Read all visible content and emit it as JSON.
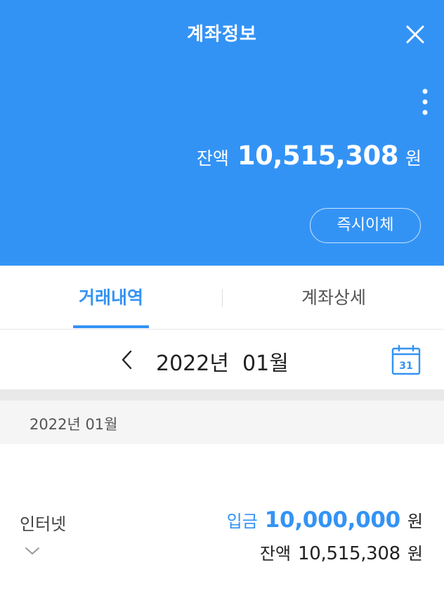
{
  "header": {
    "title": "계좌정보",
    "close_icon": "close-icon",
    "more_icon": "more-vertical-icon",
    "balance_label": "잔액",
    "balance_amount": "10,515,308",
    "balance_unit": "원",
    "transfer_button": "즉시이체"
  },
  "tabs": {
    "items": [
      {
        "label": "거래내역",
        "active": true
      },
      {
        "label": "계좌상세",
        "active": false
      }
    ]
  },
  "month_nav": {
    "prev_icon": "chevron-left-icon",
    "label": "2022년  01월",
    "calendar_icon": "calendar-icon",
    "calendar_day": "31"
  },
  "section": {
    "label": "2022년 01월"
  },
  "transactions": [
    {
      "name": "인터넷",
      "type": "입금",
      "amount": "10,000,000",
      "unit": "원",
      "balance_label": "잔액",
      "balance_amount": "10,515,308",
      "balance_unit": "원",
      "expand_icon": "chevron-down-icon"
    }
  ],
  "colors": {
    "primary": "#3393f5",
    "tab_inactive": "#555555",
    "section_bg": "#f5f5f5",
    "separator": "#e9e9e9",
    "text_dark": "#222222"
  }
}
